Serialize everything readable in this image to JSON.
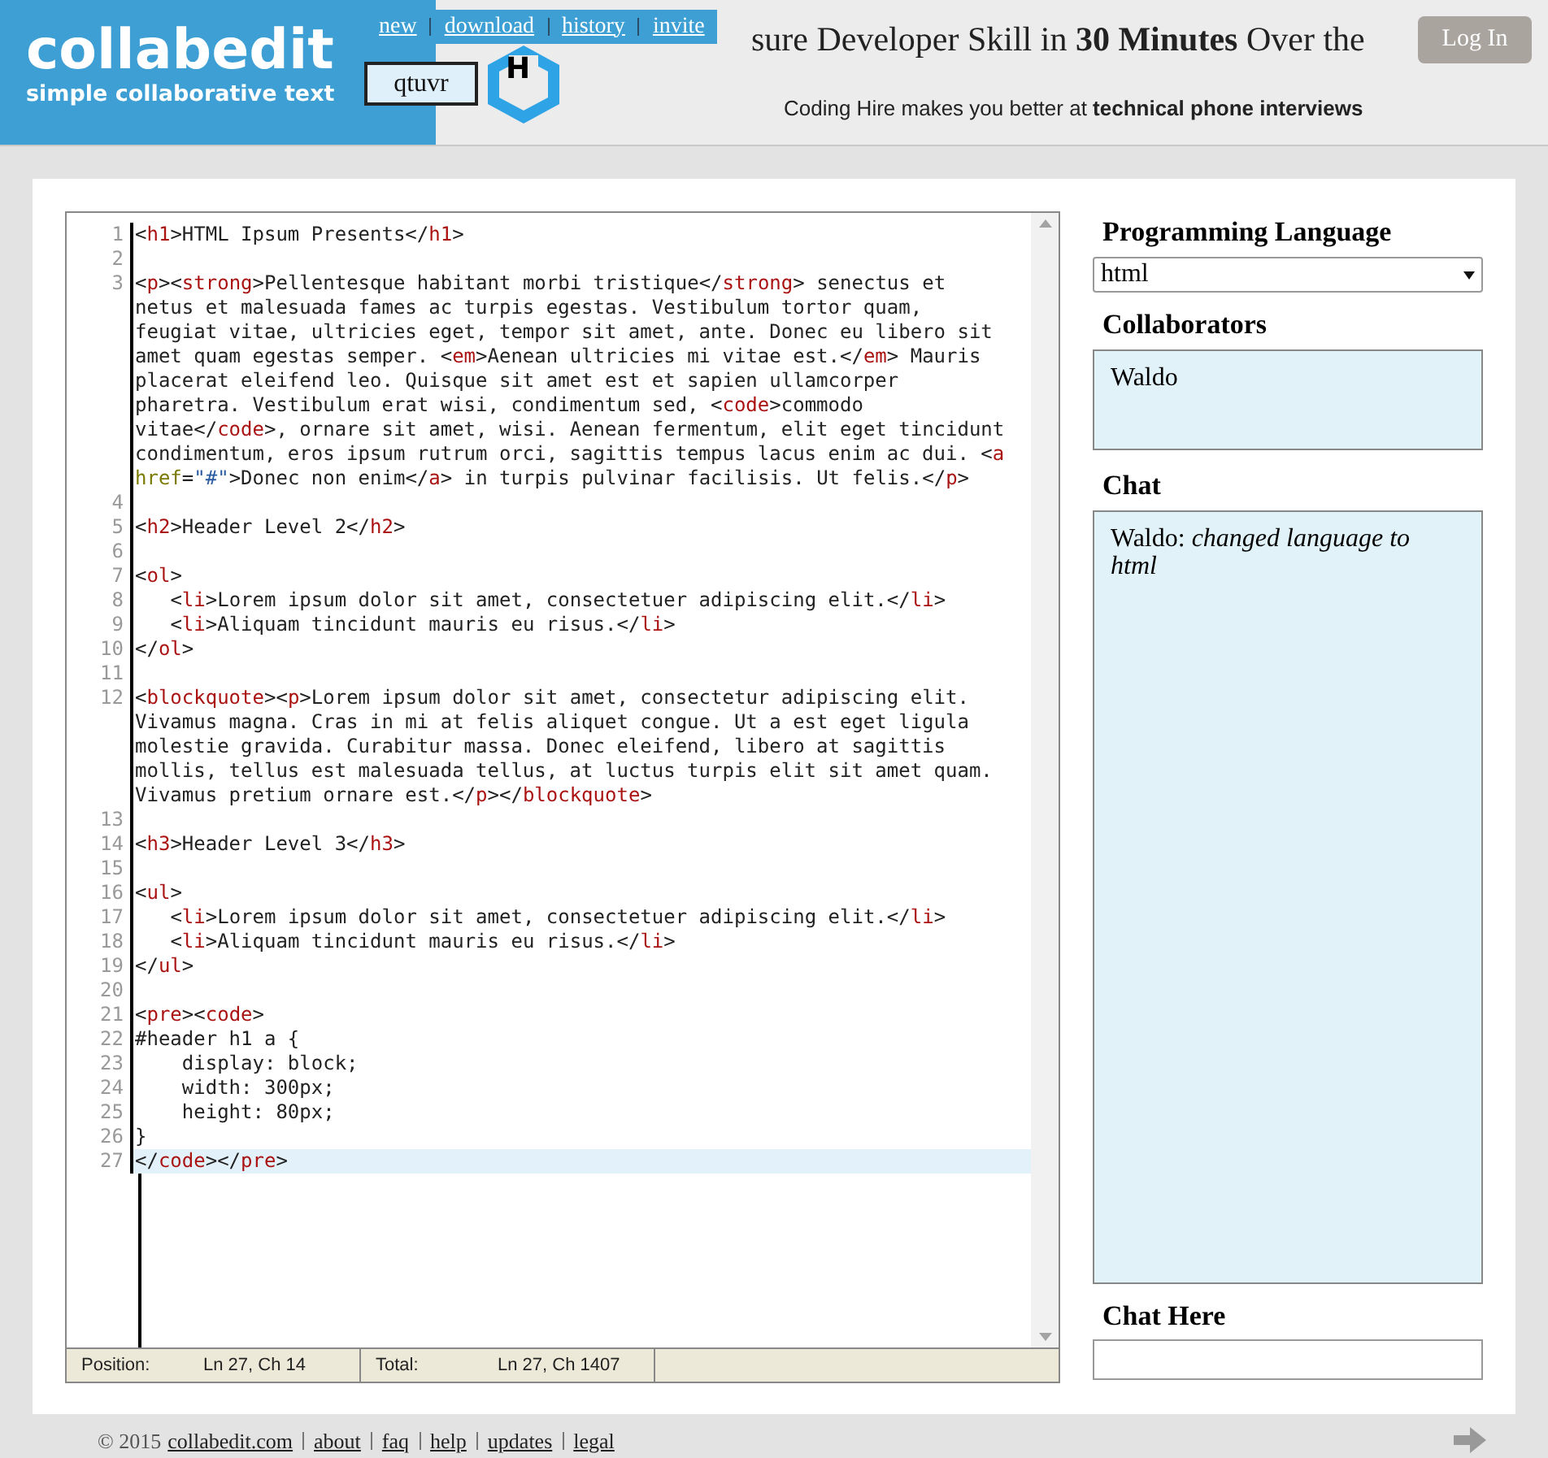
{
  "header": {
    "logo": {
      "title": "collabedit",
      "tagline": "simple collaborative text"
    },
    "nav": [
      {
        "label": "new"
      },
      {
        "label": "download"
      },
      {
        "label": "history"
      },
      {
        "label": "invite"
      }
    ],
    "document_name": "qtuvr",
    "ad": {
      "logo_letter": "H",
      "headline": "sure Developer Skill in **30 Minutes** Over the",
      "subline": "Coding Hire makes you better at **technical phone interviews**"
    },
    "login_button": "Log In"
  },
  "editor": {
    "lines": [
      {
        "number": "1",
        "active": false,
        "tokens": [
          {
            "kind": "text",
            "text": "<"
          },
          {
            "kind": "tag",
            "text": "h1"
          },
          {
            "kind": "text",
            "text": ">HTML Ipsum Presents</"
          },
          {
            "kind": "tag",
            "text": "h1"
          },
          {
            "kind": "text",
            "text": ">"
          }
        ]
      },
      {
        "number": "2",
        "active": false
      },
      {
        "number": "3",
        "active": false,
        "tokens": [
          {
            "kind": "text",
            "text": "<"
          },
          {
            "kind": "tag",
            "text": "p"
          },
          {
            "kind": "text",
            "text": "><"
          },
          {
            "kind": "tag",
            "text": "strong"
          },
          {
            "kind": "text",
            "text": ">Pellentesque habitant morbi tristique</"
          },
          {
            "kind": "tag",
            "text": "strong"
          },
          {
            "kind": "text",
            "text": "> senectus et netus et malesuada fames ac turpis egestas. Vestibulum tortor quam, feugiat vitae, ultricies eget, tempor sit amet, ante. Donec eu libero sit amet quam egestas semper. <"
          },
          {
            "kind": "tag",
            "text": "em"
          },
          {
            "kind": "text",
            "text": ">Aenean ultricies mi vitae est.</"
          },
          {
            "kind": "tag",
            "text": "em"
          },
          {
            "kind": "text",
            "text": "> Mauris placerat eleifend leo. Quisque sit amet est et sapien ullamcorper pharetra. Vestibulum erat wisi, condimentum sed, <"
          },
          {
            "kind": "tag",
            "text": "code"
          },
          {
            "kind": "text",
            "text": ">commodo vitae</"
          },
          {
            "kind": "tag",
            "text": "code"
          },
          {
            "kind": "text",
            "text": ">, ornare sit amet, wisi. Aenean fermentum, elit eget tincidunt condimentum, eros ipsum rutrum orci, sagittis tempus lacus enim ac dui. <"
          },
          {
            "kind": "tag",
            "text": "a"
          },
          {
            "kind": "attribute",
            "text": " href"
          },
          {
            "kind": "text",
            "text": "="
          },
          {
            "kind": "string",
            "text": "\"#\""
          },
          {
            "kind": "text",
            "text": ">Donec non enim</"
          },
          {
            "kind": "tag",
            "text": "a"
          },
          {
            "kind": "text",
            "text": "> in turpis pulvinar facilisis. Ut felis.</"
          },
          {
            "kind": "tag",
            "text": "p"
          },
          {
            "kind": "text",
            "text": ">"
          }
        ]
      },
      {
        "number": "4",
        "active": false
      },
      {
        "number": "5",
        "active": false,
        "tokens": [
          {
            "kind": "text",
            "text": "<"
          },
          {
            "kind": "tag",
            "text": "h2"
          },
          {
            "kind": "text",
            "text": ">Header Level 2</"
          },
          {
            "kind": "tag",
            "text": "h2"
          },
          {
            "kind": "text",
            "text": ">"
          }
        ]
      },
      {
        "number": "6",
        "active": false
      },
      {
        "number": "7",
        "active": false,
        "tokens": [
          {
            "kind": "text",
            "text": "<"
          },
          {
            "kind": "tag",
            "text": "ol"
          },
          {
            "kind": "text",
            "text": ">"
          }
        ]
      },
      {
        "number": "8",
        "active": false,
        "tokens": [
          {
            "kind": "text",
            "text": "   <"
          },
          {
            "kind": "tag",
            "text": "li"
          },
          {
            "kind": "text",
            "text": ">Lorem ipsum dolor sit amet, consectetuer adipiscing elit.</"
          },
          {
            "kind": "tag",
            "text": "li"
          },
          {
            "kind": "text",
            "text": ">"
          }
        ]
      },
      {
        "number": "9",
        "active": false,
        "tokens": [
          {
            "kind": "text",
            "text": "   <"
          },
          {
            "kind": "tag",
            "text": "li"
          },
          {
            "kind": "text",
            "text": ">Aliquam tincidunt mauris eu risus.</"
          },
          {
            "kind": "tag",
            "text": "li"
          },
          {
            "kind": "text",
            "text": ">"
          }
        ]
      },
      {
        "number": "10",
        "active": false,
        "tokens": [
          {
            "kind": "text",
            "text": "</"
          },
          {
            "kind": "tag",
            "text": "ol"
          },
          {
            "kind": "text",
            "text": ">"
          }
        ]
      },
      {
        "number": "11",
        "active": false
      },
      {
        "number": "12",
        "active": false,
        "tokens": [
          {
            "kind": "text",
            "text": "<"
          },
          {
            "kind": "tag",
            "text": "blockquote"
          },
          {
            "kind": "text",
            "text": "><"
          },
          {
            "kind": "tag",
            "text": "p"
          },
          {
            "kind": "text",
            "text": ">Lorem ipsum dolor sit amet, consectetur adipiscing elit. Vivamus magna. Cras in mi at felis aliquet congue. Ut a est eget ligula molestie gravida. Curabitur massa. Donec eleifend, libero at sagittis mollis, tellus est malesuada tellus, at luctus turpis elit sit amet quam. Vivamus pretium ornare est.</"
          },
          {
            "kind": "tag",
            "text": "p"
          },
          {
            "kind": "text",
            "text": "></"
          },
          {
            "kind": "tag",
            "text": "blockquote"
          },
          {
            "kind": "text",
            "text": ">"
          }
        ]
      },
      {
        "number": "13",
        "active": false
      },
      {
        "number": "14",
        "active": false,
        "tokens": [
          {
            "kind": "text",
            "text": "<"
          },
          {
            "kind": "tag",
            "text": "h3"
          },
          {
            "kind": "text",
            "text": ">Header Level 3</"
          },
          {
            "kind": "tag",
            "text": "h3"
          },
          {
            "kind": "text",
            "text": ">"
          }
        ]
      },
      {
        "number": "15",
        "active": false
      },
      {
        "number": "16",
        "active": false,
        "tokens": [
          {
            "kind": "text",
            "text": "<"
          },
          {
            "kind": "tag",
            "text": "ul"
          },
          {
            "kind": "text",
            "text": ">"
          }
        ]
      },
      {
        "number": "17",
        "active": false,
        "tokens": [
          {
            "kind": "text",
            "text": "   <"
          },
          {
            "kind": "tag",
            "text": "li"
          },
          {
            "kind": "text",
            "text": ">Lorem ipsum dolor sit amet, consectetuer adipiscing elit.</"
          },
          {
            "kind": "tag",
            "text": "li"
          },
          {
            "kind": "text",
            "text": ">"
          }
        ]
      },
      {
        "number": "18",
        "active": false,
        "tokens": [
          {
            "kind": "text",
            "text": "   <"
          },
          {
            "kind": "tag",
            "text": "li"
          },
          {
            "kind": "text",
            "text": ">Aliquam tincidunt mauris eu risus.</"
          },
          {
            "kind": "tag",
            "text": "li"
          },
          {
            "kind": "text",
            "text": ">"
          }
        ]
      },
      {
        "number": "19",
        "active": false,
        "tokens": [
          {
            "kind": "text",
            "text": "</"
          },
          {
            "kind": "tag",
            "text": "ul"
          },
          {
            "kind": "text",
            "text": ">"
          }
        ]
      },
      {
        "number": "20",
        "active": false
      },
      {
        "number": "21",
        "active": false,
        "tokens": [
          {
            "kind": "text",
            "text": "<"
          },
          {
            "kind": "tag",
            "text": "pre"
          },
          {
            "kind": "text",
            "text": "><"
          },
          {
            "kind": "tag",
            "text": "code"
          },
          {
            "kind": "text",
            "text": ">"
          }
        ]
      },
      {
        "number": "22",
        "active": false,
        "tokens": [
          {
            "kind": "text",
            "text": "#header h1 a {"
          }
        ]
      },
      {
        "number": "23",
        "active": false,
        "tokens": [
          {
            "kind": "text",
            "text": "    display: block;"
          }
        ]
      },
      {
        "number": "24",
        "active": false,
        "tokens": [
          {
            "kind": "text",
            "text": "    width: 300px;"
          }
        ]
      },
      {
        "number": "25",
        "active": false,
        "tokens": [
          {
            "kind": "text",
            "text": "    height: 80px;"
          }
        ]
      },
      {
        "number": "26",
        "active": false,
        "tokens": [
          {
            "kind": "text",
            "text": "}"
          }
        ]
      },
      {
        "number": "27",
        "active": true,
        "tokens": [
          {
            "kind": "text",
            "text": "</"
          },
          {
            "kind": "tag",
            "text": "code"
          },
          {
            "kind": "text",
            "text": "></"
          },
          {
            "kind": "tag",
            "text": "pre"
          },
          {
            "kind": "text",
            "text": ">"
          }
        ]
      }
    ],
    "status_bar": [
      {
        "label": "Position:",
        "value": "Ln 27, Ch 14"
      },
      {
        "label": "Total:",
        "value": "Ln 27, Ch 1407"
      }
    ]
  },
  "sidebar": {
    "language_label": "Programming Language",
    "language": "html",
    "collaborators_label": "Collaborators",
    "collaborators": [
      "Waldo"
    ],
    "chat_label": "Chat",
    "chat": [
      {
        "author": "Waldo:",
        "message": "changed language to html"
      }
    ],
    "chat_input_label": "Chat Here"
  },
  "footer": {
    "copyright": "© 2015",
    "links": [
      {
        "label": "collabedit.com"
      },
      {
        "label": "about"
      },
      {
        "label": "faq"
      },
      {
        "label": "help"
      },
      {
        "label": "updates"
      },
      {
        "label": "legal"
      }
    ]
  }
}
